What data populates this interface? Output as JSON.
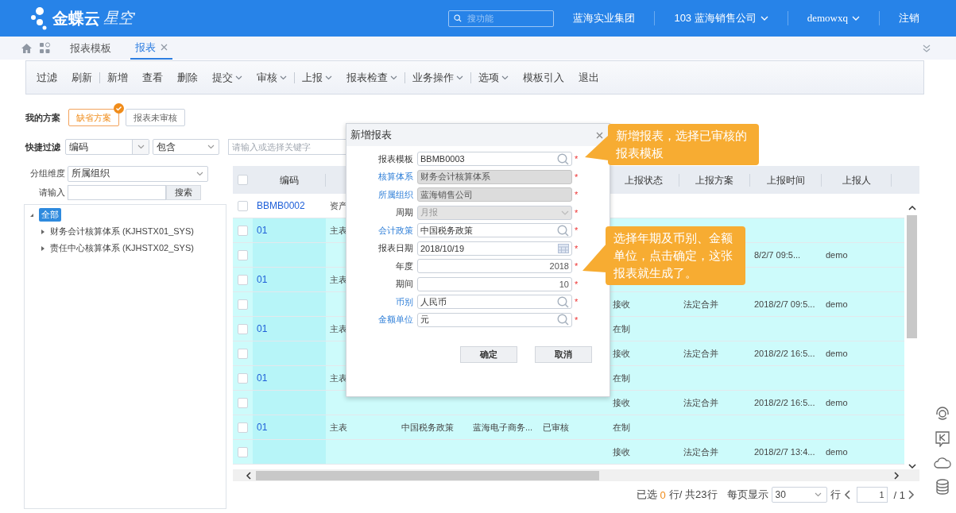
{
  "header": {
    "brand": "金蝶云",
    "product": "星空",
    "search": {
      "placeholder": "搜功能"
    },
    "org_group": "蓝海实业集团",
    "org": "103 蓝海销售公司",
    "user": "demowxq",
    "logout": "注销"
  },
  "tabs": [
    {
      "label": "报表模板",
      "selected": false,
      "closable": false
    },
    {
      "label": "报表",
      "selected": true,
      "closable": true
    }
  ],
  "toolbar": [
    {
      "label": "过滤",
      "dropdown": false,
      "divider_before": false
    },
    {
      "label": "刷新",
      "dropdown": false,
      "divider_before": false
    },
    {
      "label": "新增",
      "dropdown": false,
      "divider_before": true
    },
    {
      "label": "查看",
      "dropdown": false,
      "divider_before": false
    },
    {
      "label": "删除",
      "dropdown": false,
      "divider_before": false
    },
    {
      "label": "提交",
      "dropdown": true,
      "divider_before": false
    },
    {
      "label": "审核",
      "dropdown": true,
      "divider_before": false
    },
    {
      "label": "上报",
      "dropdown": true,
      "divider_before": true
    },
    {
      "label": "报表检查",
      "dropdown": true,
      "divider_before": false
    },
    {
      "label": "业务操作",
      "dropdown": true,
      "divider_before": true
    },
    {
      "label": "选项",
      "dropdown": true,
      "divider_before": true
    },
    {
      "label": "模板引入",
      "dropdown": false,
      "divider_before": false
    },
    {
      "label": "退出",
      "dropdown": false,
      "divider_before": false
    }
  ],
  "schemes": {
    "label": "我的方案",
    "items": [
      {
        "label": "缺省方案",
        "selected": true
      },
      {
        "label": "报表未审核",
        "selected": false
      }
    ]
  },
  "quick_filter": {
    "label": "快捷过滤",
    "field": "编码",
    "operator": "包含",
    "keyword_placeholder": "请输入或选择关键字"
  },
  "group": {
    "label": "分组维度",
    "value": "所属组织",
    "input_label": "请输入",
    "search_button": "搜索"
  },
  "tree": [
    {
      "label": "全部",
      "selected": true,
      "expanded": true,
      "children": [
        {
          "label": "财务会计核算体系 (KJHSTX01_SYS)",
          "selected": false,
          "expanded": false
        },
        {
          "label": "责任中心核算体系 (KJHSTX02_SYS)",
          "selected": false,
          "expanded": false
        }
      ]
    }
  ],
  "table": {
    "header_checked": false,
    "header": {
      "code": "编码",
      "report_status": "上报状态",
      "report_scheme": "上报方案",
      "report_time": "上报时间",
      "reporter": "上报人"
    },
    "rows": [
      {
        "checked": false,
        "highlighted": false,
        "code": "BBMB0002",
        "column_2": "资产"
      },
      {
        "checked": false,
        "highlighted": true,
        "code": "01",
        "column_2": "主表"
      },
      {
        "checked": false,
        "highlighted": true,
        "report_time": "8/2/7 09:5...",
        "reporter": "demo"
      },
      {
        "checked": false,
        "highlighted": true,
        "code": "01",
        "column_2": "主表"
      },
      {
        "checked": false,
        "highlighted": true,
        "report_status": "接收",
        "report_scheme": "法定合并",
        "report_time": "2018/2/7 09:5...",
        "reporter": "demo"
      },
      {
        "checked": false,
        "highlighted": true,
        "code": "01",
        "column_2": "主表",
        "report_status": "在制"
      },
      {
        "checked": false,
        "highlighted": true,
        "report_status": "接收",
        "report_scheme": "法定合并",
        "report_time": "2018/2/2 16:5...",
        "reporter": "demo"
      },
      {
        "checked": false,
        "highlighted": true,
        "code": "01",
        "column_2": "主表",
        "report_status": "在制"
      },
      {
        "checked": false,
        "highlighted": true,
        "report_status": "接收",
        "report_scheme": "法定合并",
        "report_time": "2018/2/2 16:5...",
        "reporter": "demo"
      },
      {
        "checked": false,
        "highlighted": true,
        "code": "01",
        "column_2": "主表",
        "column_3": "中国税务政策",
        "column_4": "蓝海电子商务...",
        "column_5": "已审核",
        "report_status": "在制"
      },
      {
        "checked": false,
        "highlighted": true,
        "report_status": "接收",
        "report_scheme": "法定合并",
        "report_time": "2018/2/7 13:4...",
        "reporter": "demo"
      }
    ]
  },
  "footer": {
    "selected_label": "已选",
    "selected_count": "0",
    "total": "行/ 共23行",
    "per_page_label": "每页显示",
    "per_page": "30",
    "rows_label": "行",
    "page": "1",
    "pages": "/ 1"
  },
  "dialog": {
    "title": "新增报表",
    "fields": [
      {
        "label": "报表模板",
        "value": "BBMB0003",
        "kind": "lookup",
        "link": false,
        "required": true,
        "required_mark": "*"
      },
      {
        "label": "核算体系",
        "value": "财务会计核算体系",
        "kind": "readonly",
        "link": true,
        "required": true,
        "required_mark": "*"
      },
      {
        "label": "所属组织",
        "value": "蓝海销售公司",
        "kind": "readonly",
        "link": true,
        "required": true,
        "required_mark": "*"
      },
      {
        "label": "周期",
        "value": "月报",
        "kind": "select",
        "link": false,
        "required": true,
        "required_mark": "*"
      },
      {
        "label": "会计政策",
        "value": "中国税务政策",
        "kind": "lookup",
        "link": true,
        "required": true,
        "required_mark": "*"
      },
      {
        "label": "报表日期",
        "value": "2018/10/19",
        "kind": "date",
        "link": false,
        "required": true,
        "required_mark": "*"
      },
      {
        "label": "年度",
        "value": "2018",
        "kind": "number",
        "link": false,
        "required": true,
        "required_mark": "*"
      },
      {
        "label": "期间",
        "value": "10",
        "kind": "number",
        "link": false,
        "required": true,
        "required_mark": "*"
      },
      {
        "label": "币别",
        "value": "人民币",
        "kind": "lookup",
        "link": true,
        "required": true,
        "required_mark": "*"
      },
      {
        "label": "金额单位",
        "value": "元",
        "kind": "lookup",
        "link": true,
        "required": true,
        "required_mark": "*"
      }
    ],
    "buttons": [
      "确定",
      "取消"
    ]
  },
  "callouts": [
    "新增报表，选择已审核的报表模板",
    "选择年期及币别、金额单位，点击确定，这张报表就生成了。"
  ]
}
